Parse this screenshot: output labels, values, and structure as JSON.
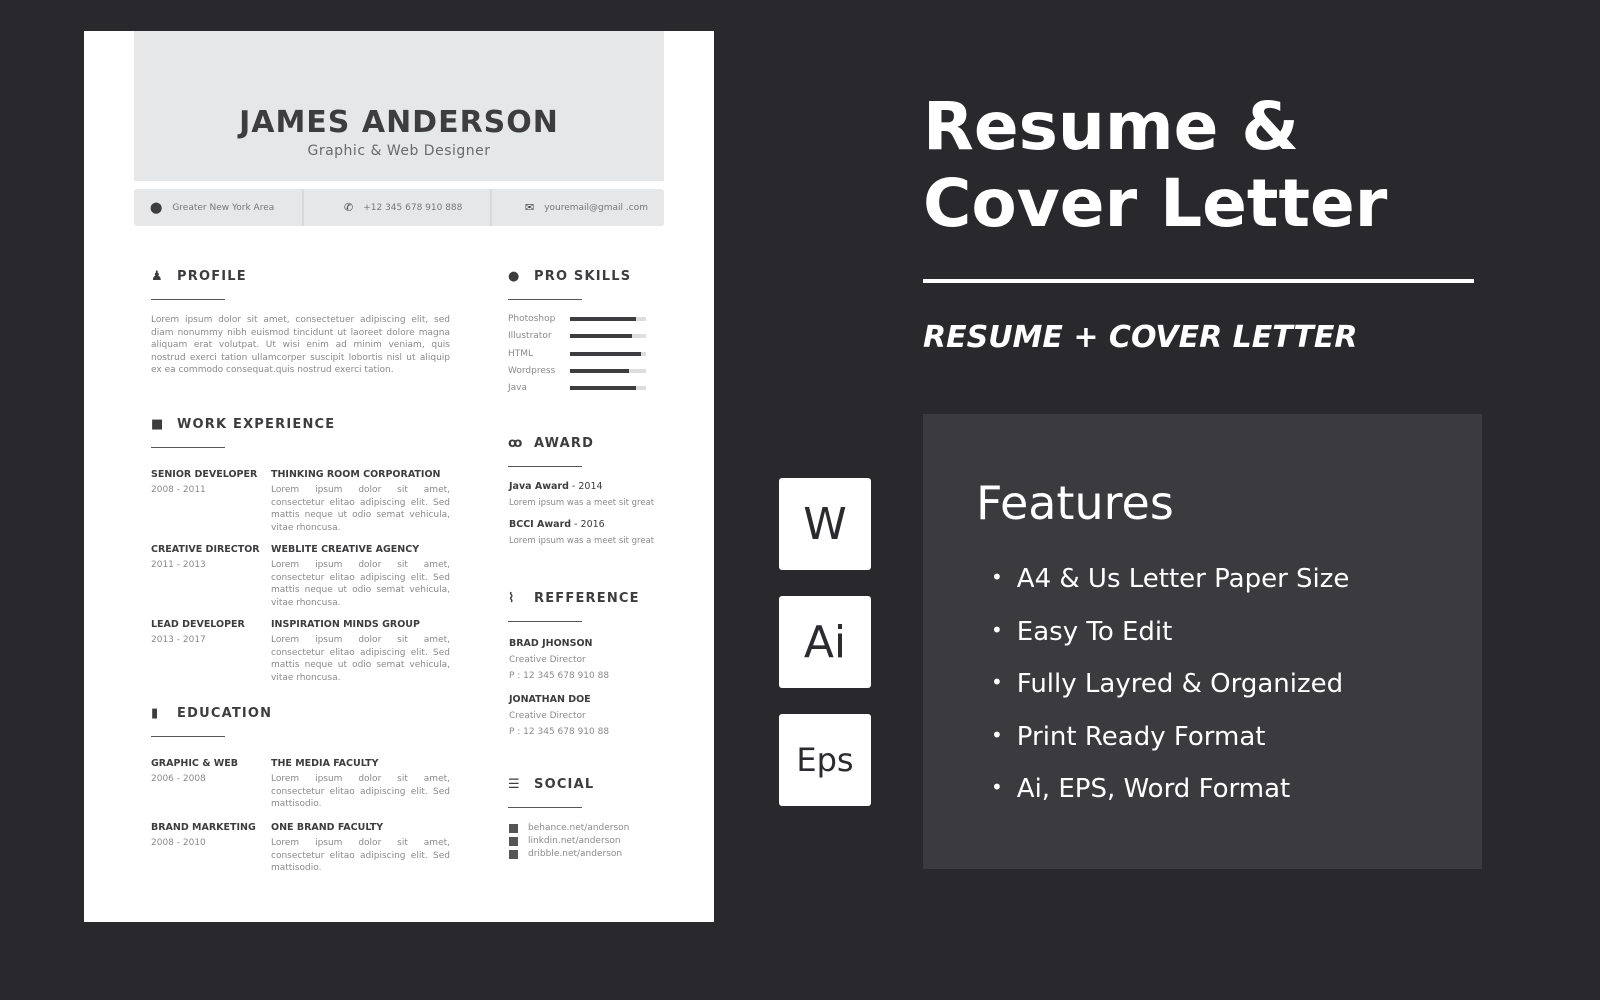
{
  "resume": {
    "name": "JAMES ANDERSON",
    "role": "Graphic & Web Designer",
    "contact": {
      "location": "Greater New York Area",
      "phone": "+12 345 678 910 888",
      "email": "youremail@gmail .com"
    },
    "profile": {
      "heading": "PROFILE",
      "text": "Lorem ipsum dolor sit amet, consectetuer adipiscing elit, sed diam nonummy nibh euismod tincidunt ut laoreet dolore magna aliquam erat volutpat. Ut wisi enim ad minim veniam, quis nostrud exerci tation ullamcorper suscipit lobortis nisl ut aliquip ex ea commodo consequat.quis nostrud exerci tation."
    },
    "work": {
      "heading": "WORK EXPERIENCE",
      "items": [
        {
          "title": "SENIOR DEVELOPER",
          "years": "2008 - 2011",
          "company": "THINKING ROOM CORPORATION",
          "text": "Lorem ipsum dolor sit amet, consectetur elitao adipiscing elit. Sed mattis neque ut odio semat vehicula, vitae rhoncusa."
        },
        {
          "title": "CREATIVE DIRECTOR",
          "years": "2011 - 2013",
          "company": "WEBLITE CREATIVE AGENCY",
          "text": "Lorem ipsum dolor sit amet, consectetur elitao adipiscing elit. Sed mattis neque ut odio semat vehicula, vitae rhoncusa."
        },
        {
          "title": "LEAD DEVELOPER",
          "years": "2013 - 2017",
          "company": "INSPIRATION MINDS GROUP",
          "text": "Lorem ipsum dolor sit amet, consectetur elitao adipiscing elit. Sed mattis neque ut odio semat vehicula, vitae rhoncusa."
        }
      ]
    },
    "education": {
      "heading": "EDUCATION",
      "items": [
        {
          "title": "GRAPHIC & WEB",
          "years": "2006 - 2008",
          "school": "THE MEDIA FACULTY",
          "text": "Lorem ipsum dolor sit amet, consectetur elitao adipiscing elit. Sed mattisodio."
        },
        {
          "title": "BRAND MARKETING",
          "years": "2008 - 2010",
          "school": "ONE BRAND FACULTY",
          "text": "Lorem ipsum dolor sit amet, consectetur elitao adipiscing elit. Sed mattisodio."
        }
      ]
    },
    "skills": {
      "heading": "PRO SKILLS",
      "items": [
        {
          "name": "Photoshop",
          "level": 0.87
        },
        {
          "name": "Illustrator",
          "level": 0.82
        },
        {
          "name": "HTML",
          "level": 0.93
        },
        {
          "name": "Wordpress",
          "level": 0.77
        },
        {
          "name": "Java",
          "level": 0.87
        }
      ]
    },
    "award": {
      "heading": "AWARD",
      "items": [
        {
          "name": "Java Award",
          "year": " - 2014",
          "text": "Lorem ipsum  was a meet sit great"
        },
        {
          "name": "BCCI Award",
          "year": " - 2016",
          "text": "Lorem ipsum  was a meet sit great"
        }
      ]
    },
    "reference": {
      "heading": "REFFERENCE",
      "items": [
        {
          "name": "BRAD JHONSON",
          "role": "Creative Director",
          "phone": "P : 12 345 678 910 88"
        },
        {
          "name": "JONATHAN DOE",
          "role": "Creative Director",
          "phone": "P : 12 345 678 910 88"
        }
      ]
    },
    "social": {
      "heading": "SOCIAL",
      "items": [
        "behance.net/anderson",
        "linkdin.net/anderson",
        "dribble.net/anderson"
      ]
    }
  },
  "promo": {
    "title_line1": "Resume &",
    "title_line2": "Cover  Letter",
    "subtitle": "RESUME + COVER LETTER",
    "formats": [
      "W",
      "Ai",
      "Eps"
    ],
    "features_title": "Features",
    "features": [
      "A4  & Us Letter Paper Size",
      "Easy To Edit",
      "Fully Layred & Organized",
      "Print Ready Format",
      "Ai, EPS, Word Format"
    ]
  },
  "colors": {
    "background": "#29282d",
    "paper": "#ffffff",
    "header_gray": "#e6e7e9",
    "feature_box": "#3b3a3f",
    "text_dark": "#3d3d3f"
  }
}
